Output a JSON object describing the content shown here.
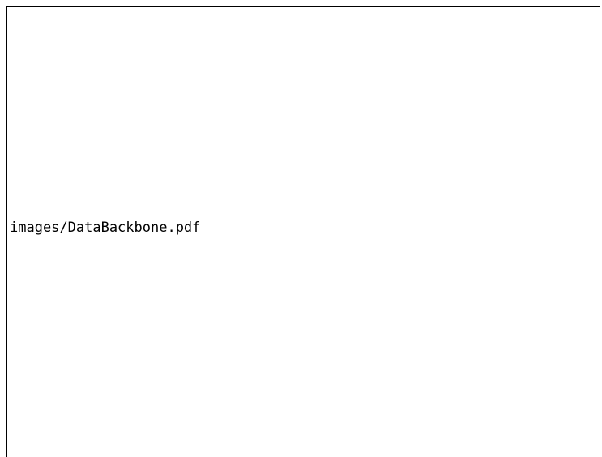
{
  "placeholder": {
    "path_text": "images/DataBackbone.pdf"
  }
}
